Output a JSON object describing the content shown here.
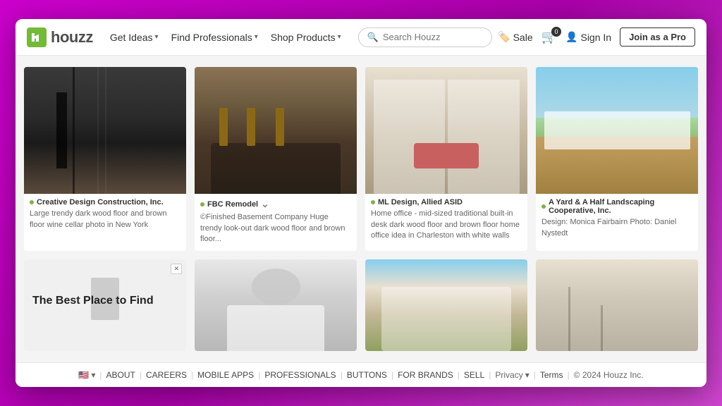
{
  "header": {
    "logo_text": "houzz",
    "nav": {
      "get_ideas": "Get Ideas",
      "find_professionals": "Find Professionals",
      "shop_products": "Shop Products"
    },
    "search": {
      "placeholder": "Search Houzz"
    },
    "actions": {
      "sale": "Sale",
      "sign_in": "Sign In",
      "join": "Join as a Pro"
    }
  },
  "images": {
    "row1": [
      {
        "author": "Creative Design Construction, Inc.",
        "desc": "Large trendy dark wood floor and brown floor wine cellar photo in New York",
        "style": "img-cellar"
      },
      {
        "author": "FBC Remodel",
        "desc": "©Finished Basement Company\nHuge trendy look-out dark wood floor and brown floor...",
        "style": "img-bar",
        "has_expand": true
      },
      {
        "author": "ML Design, Allied ASID",
        "desc": "Home office - mid-sized traditional built-in desk dark wood floor and brown floor home office idea in Charleston with white walls",
        "style": "img-office"
      },
      {
        "author": "A Yard & A Half Landscaping Cooperative, Inc.",
        "desc": "Design: Monica Fairbairn Photo: Daniel Nystedt",
        "style": "img-outdoor"
      }
    ],
    "row2": [
      {
        "ad": true,
        "ad_text": "The Best Place to Find",
        "style": "img-ad"
      },
      {
        "author": "",
        "desc": "",
        "style": "img-kitchen"
      },
      {
        "author": "",
        "desc": "",
        "style": "img-house"
      },
      {
        "author": "",
        "desc": "",
        "style": "img-stairs2"
      }
    ]
  },
  "scroll": {
    "current": "1"
  },
  "footer": {
    "flag": "🇺🇸",
    "links": [
      "ABOUT",
      "CAREERS",
      "MOBILE APPS",
      "PROFESSIONALS",
      "BUTTONS",
      "FOR BRANDS",
      "SELL"
    ],
    "privacy": "Privacy",
    "terms": "Terms",
    "copyright": "© 2024 Houzz Inc."
  }
}
